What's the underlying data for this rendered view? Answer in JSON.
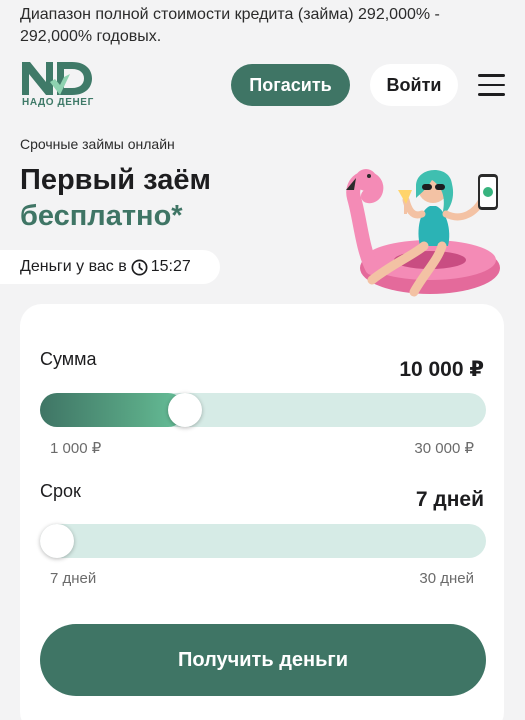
{
  "disclaimer": "Диапазон полной стоимости кредита (займа) 292,000% - 292,000% годовых.",
  "header": {
    "logo_mark": "ND",
    "logo_text": "НАДО ДЕНЕГ",
    "repay_label": "Погасить",
    "login_label": "Войти",
    "menu_icon": "hamburger-icon"
  },
  "hero": {
    "subtitle": "Срочные займы онлайн",
    "title_line1": "Первый заём",
    "title_line2": "бесплатно*",
    "money_prefix": "Деньги у вас в",
    "money_time": "15:27",
    "clock_icon": "clock-icon"
  },
  "calculator": {
    "amount": {
      "label": "Сумма",
      "value": "10 000 ₽",
      "min_label": "1 000 ₽",
      "max_label": "30 000 ₽",
      "level": 0.31
    },
    "term": {
      "label": "Срок",
      "value": "7 дней",
      "min_label": "7 дней",
      "max_label": "30 дней",
      "level": 0
    },
    "submit_label": "Получить деньги"
  },
  "colors": {
    "brand": "#3f7565",
    "track": "#d6ebe6",
    "background": "#f3f3f4"
  }
}
